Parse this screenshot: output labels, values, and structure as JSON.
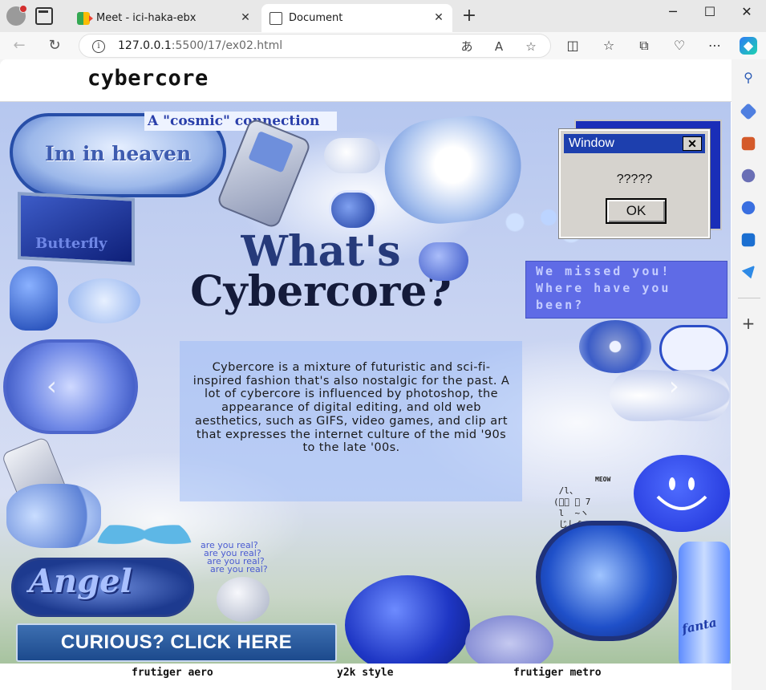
{
  "browser": {
    "tabs": [
      {
        "title": "Meet - ici-haka-ebx",
        "close": "✕"
      },
      {
        "title": "Document",
        "close": "✕"
      }
    ],
    "new_tab": "+",
    "window_controls": {
      "minimize": "─",
      "maximize": "☐",
      "close": "✕"
    },
    "url_host": "127.0.0.1",
    "url_rest": ":5500/17/ex02.html"
  },
  "page": {
    "logo": "cybercore",
    "banner": {
      "cosmic": "A \"cosmic\" connection",
      "heaven": "Im in heaven",
      "butterfly": "Butterfly",
      "headline_line1": "What's",
      "headline_line2": "Cybercore?",
      "missed": "We missed you! Where have you been?",
      "window_title": "Window",
      "window_close": "✕",
      "window_message": "?????",
      "window_ok": "OK",
      "description": "Cybercore is a mixture of futuristic and sci-fi-inspired fashion that's also nostalgic for the past. A lot of cybercore is influenced by photoshop, the appearance of digital editing, and old web aesthetics, such as GIFS, video games, and clip art that expresses the internet culture of the mid '90s to the late '00s.",
      "meow": "MEOW",
      "ascii_cat": " ∕l、\n(ﾟ､ ｡ 7\n l  ~ヽ\n じしf_,)ノ",
      "are_you_real": [
        "are you real?",
        "are you real?",
        "are you real?",
        "are you real?"
      ],
      "angel": "Angel",
      "fanta": "fanta",
      "cta": "CURIOUS? CLICK HERE",
      "prev": "‹",
      "next": "›"
    },
    "tags": [
      "frutiger aero",
      "y2k style",
      "frutiger metro"
    ]
  }
}
